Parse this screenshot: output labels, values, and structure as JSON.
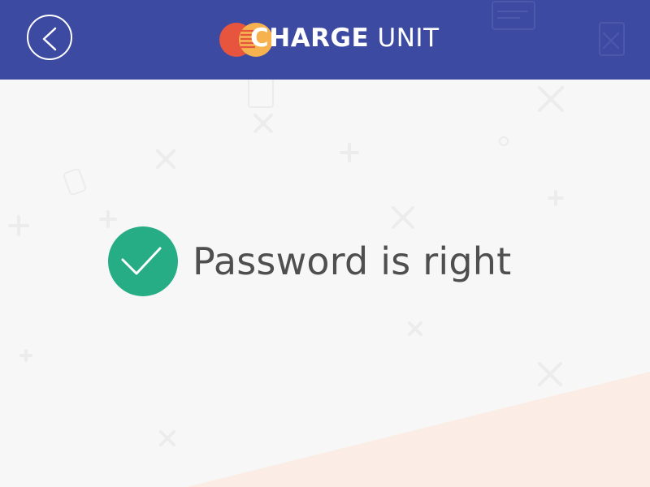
{
  "header": {
    "back_icon": "chevron-left-icon",
    "brand_bold": "CHARGE",
    "brand_light": "UNIT",
    "logo_icon": "overlapping-circles-logo-icon",
    "colors": {
      "bar": "#3d4aa2",
      "logo_red": "#e8553e",
      "logo_orange": "#f6b24e"
    }
  },
  "status": {
    "icon": "check-circle-icon",
    "message": "Password is right",
    "colors": {
      "success": "#26ad85",
      "text": "#4f4f4f"
    }
  },
  "background": {
    "color": "#f7f7f7",
    "accent_color": "#fbece6"
  }
}
